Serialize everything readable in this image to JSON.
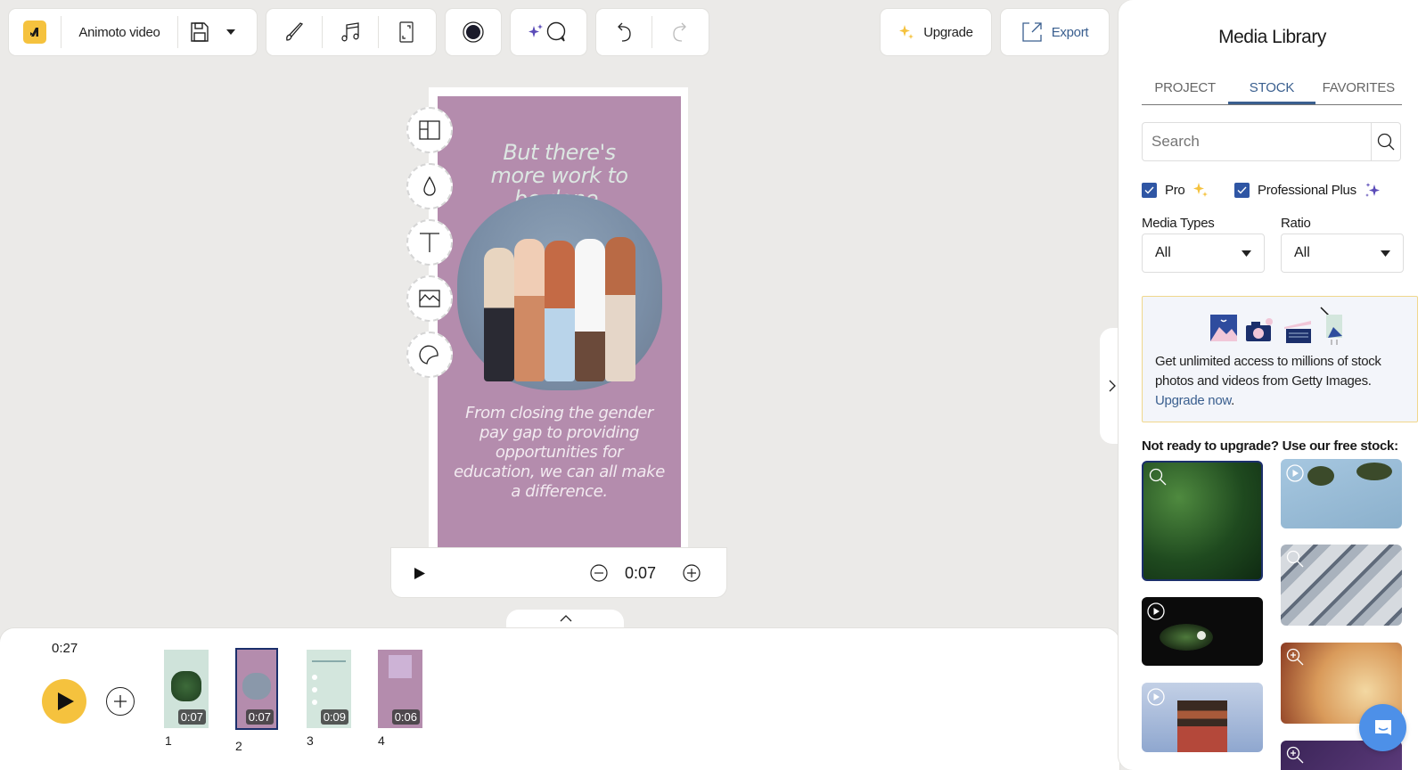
{
  "toolbar": {
    "project_name": "Animoto video",
    "logo_icon": "animoto-logo-icon",
    "save_icon": "floppy-disk-icon",
    "save_menu_icon": "caret-down-icon",
    "tools": [
      {
        "name": "design-brush-icon"
      },
      {
        "name": "music-note-icon"
      },
      {
        "name": "aspect-ratio-icon"
      }
    ],
    "record_icon": "record-icon",
    "ai_icon": "sparkle-chat-icon",
    "undo_icon": "undo-icon",
    "redo_icon": "redo-icon",
    "upgrade_label": "Upgrade",
    "export_label": "Export"
  },
  "canvas": {
    "headline": "But there's more work to be done.",
    "body": "From closing the gender pay gap to providing opportunities for education, we can all make a difference.",
    "side_tools": [
      "layout-icon",
      "color-drop-icon",
      "text-icon",
      "image-icon",
      "sticker-icon"
    ],
    "playbar": {
      "time": "0:07"
    }
  },
  "timeline": {
    "total_duration": "0:27",
    "scenes": [
      {
        "number": "1",
        "duration": "0:07",
        "selected": false,
        "bg": "#cfe3da"
      },
      {
        "number": "2",
        "duration": "0:07",
        "selected": true,
        "bg": "#b48cad"
      },
      {
        "number": "3",
        "duration": "0:09",
        "selected": false,
        "bg": "#d3e6dd"
      },
      {
        "number": "4",
        "duration": "0:06",
        "selected": false,
        "bg": "#b48cad"
      }
    ]
  },
  "panel": {
    "title": "Media Library",
    "tabs": [
      {
        "label": "PROJECT",
        "active": false
      },
      {
        "label": "STOCK",
        "active": true
      },
      {
        "label": "FAVORITES",
        "active": false
      }
    ],
    "search_placeholder": "Search",
    "filters": {
      "pro_label": "Pro",
      "pro_checked": true,
      "plus_label": "Professional Plus",
      "plus_checked": true
    },
    "media_types_label": "Media Types",
    "media_types_value": "All",
    "ratio_label": "Ratio",
    "ratio_value": "All",
    "promo_text": "Get unlimited access to millions of stock photos and videos from Getty Images.",
    "promo_link": "Upgrade now",
    "free_heading": "Not ready to upgrade? Use our free stock:",
    "thumbnails": [
      {
        "subject": "basil leaves",
        "kind": "image",
        "selected": true
      },
      {
        "subject": "palm trees",
        "kind": "video"
      },
      {
        "subject": "highway overpass",
        "kind": "image"
      },
      {
        "subject": "white flower",
        "kind": "video"
      },
      {
        "subject": "autumn leaves sunset",
        "kind": "image"
      },
      {
        "subject": "pagoda",
        "kind": "video"
      },
      {
        "subject": "purple sky",
        "kind": "image"
      }
    ]
  },
  "colors": {
    "accent_yellow": "#f5c23e",
    "accent_blue": "#3a5f8f",
    "checkbox_blue": "#2f56a4",
    "slide_purple": "#b48cad",
    "chat_blue": "#4d90e8"
  }
}
